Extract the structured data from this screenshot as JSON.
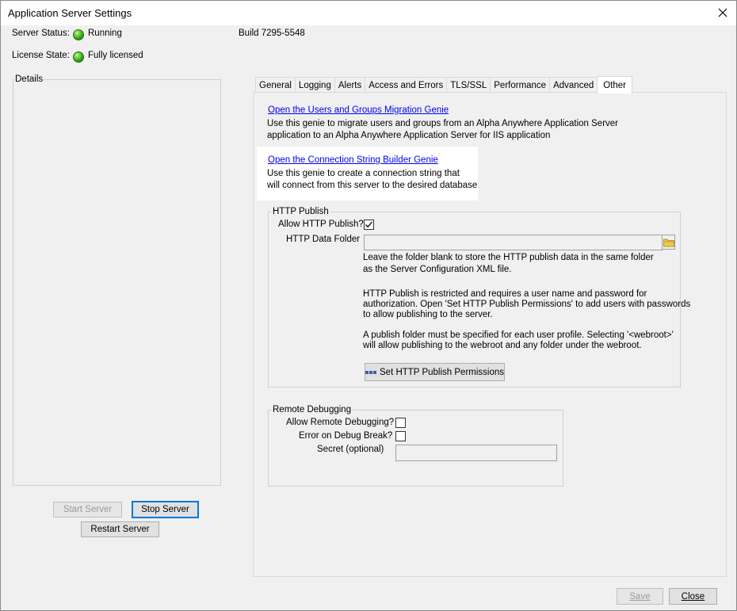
{
  "window": {
    "title": "Application Server Settings"
  },
  "status": {
    "server_status_label": "Server Status:",
    "server_status_value": "Running",
    "license_state_label": "License State:",
    "license_state_value": "Fully licensed",
    "build": "Build 7295-5548"
  },
  "details": {
    "label": "Details"
  },
  "server_buttons": {
    "start": "Start Server",
    "stop": "Stop Server",
    "restart": "Restart Server"
  },
  "tabs": [
    {
      "label": "General"
    },
    {
      "label": "Logging"
    },
    {
      "label": "Alerts"
    },
    {
      "label": "Access and Errors"
    },
    {
      "label": "TLS/SSL"
    },
    {
      "label": "Performance"
    },
    {
      "label": "Advanced"
    },
    {
      "label": "Other",
      "active": true
    }
  ],
  "other": {
    "migration_link": "Open the Users and Groups Migration Genie",
    "migration_desc_1": "Use this genie to migrate users and groups from an Alpha Anywhere Application Server",
    "migration_desc_2": "application to an Alpha Anywhere Application Server for IIS application",
    "connstr_link": "Open the Connection String Builder Genie",
    "connstr_desc_1": "Use this genie to create a connection string that",
    "connstr_desc_2": "will connect from this server to the desired database"
  },
  "http_publish": {
    "group_label": "HTTP Publish",
    "allow_label": "Allow HTTP Publish?",
    "allow_checked": true,
    "folder_label": "HTTP Data Folder",
    "folder_value": "",
    "note1_1": "Leave the folder blank to store the HTTP publish data in the same folder",
    "note1_2": "as the Server Configuration XML file.",
    "note2_1": "HTTP Publish is restricted and requires a user name and password for",
    "note2_2": "authorization. Open 'Set HTTP Publish Permissions' to add users with passwords",
    "note2_3": "to allow publishing to the server.",
    "note3_1": "A publish folder must be specified for each user profile.  Selecting '<webroot>'",
    "note3_2": "will allow publishing to the webroot and any folder under the webroot.",
    "permissions_button": "Set HTTP Publish Permissions"
  },
  "remote_debugging": {
    "group_label": "Remote Debugging",
    "allow_label": "Allow Remote Debugging?",
    "allow_checked": false,
    "error_label": "Error on Debug Break?",
    "error_checked": false,
    "secret_label": "Secret (optional)",
    "secret_value": ""
  },
  "footer": {
    "save": "Save",
    "close": "Close"
  }
}
